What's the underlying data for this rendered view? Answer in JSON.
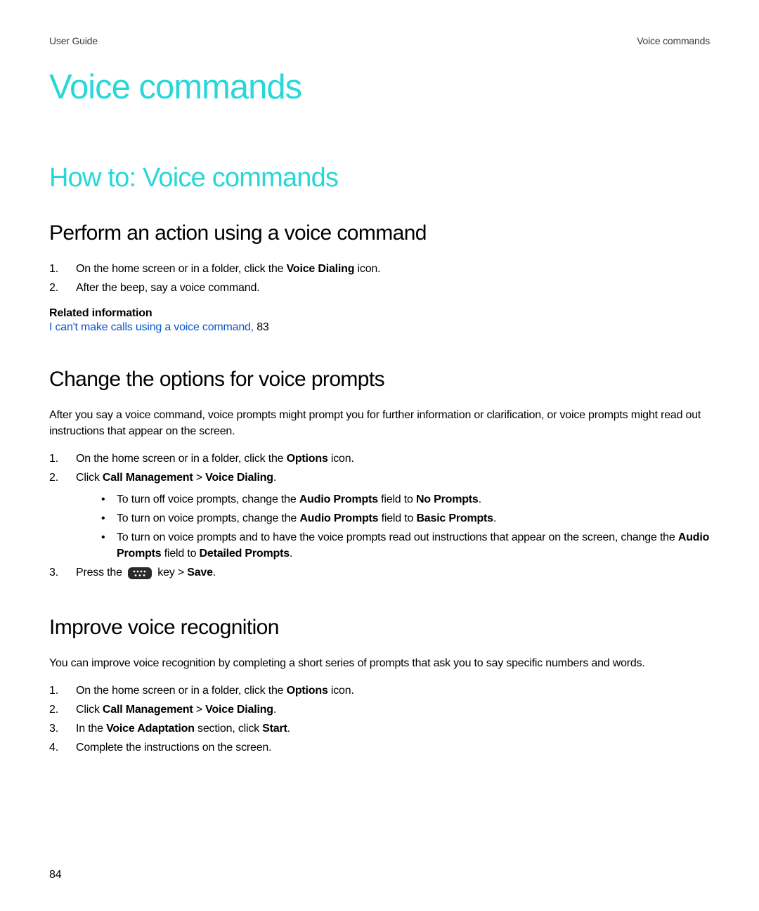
{
  "header": {
    "left": "User Guide",
    "right": "Voice commands"
  },
  "title": "Voice commands",
  "section": "How to: Voice commands",
  "sub1": {
    "title": "Perform an action using a voice command",
    "step1_pre": "On the home screen or in a folder, click the ",
    "step1_bold": "Voice Dialing",
    "step1_post": " icon.",
    "step2": "After the beep, say a voice command.",
    "related_heading": "Related information",
    "related_link": "I can't make calls using a voice command, ",
    "related_page": "83"
  },
  "sub2": {
    "title": "Change the options for voice prompts",
    "intro": "After you say a voice command, voice prompts might prompt you for further information or clarification, or voice prompts might read out instructions that appear on the screen.",
    "step1_pre": "On the home screen or in a folder, click the ",
    "step1_bold": "Options",
    "step1_post": " icon.",
    "step2_pre": "Click ",
    "step2_b1": "Call Management",
    "step2_mid": " > ",
    "step2_b2": "Voice Dialing",
    "step2_post": ".",
    "bullet1_pre": "To turn off voice prompts, change the ",
    "bullet1_b1": "Audio Prompts",
    "bullet1_mid": " field to ",
    "bullet1_b2": "No Prompts",
    "bullet1_post": ".",
    "bullet2_pre": "To turn on voice prompts, change the ",
    "bullet2_b1": "Audio Prompts",
    "bullet2_mid": " field to ",
    "bullet2_b2": "Basic Prompts",
    "bullet2_post": ".",
    "bullet3_pre": "To turn on voice prompts and to have the voice prompts read out instructions that appear on the screen, change the ",
    "bullet3_b1": "Audio Prompts",
    "bullet3_mid": " field to ",
    "bullet3_b2": "Detailed Prompts",
    "bullet3_post": ".",
    "step3_pre": "Press the ",
    "step3_mid": " key > ",
    "step3_bold": "Save",
    "step3_post": "."
  },
  "sub3": {
    "title": "Improve voice recognition",
    "intro": "You can improve voice recognition by completing a short series of prompts that ask you to say specific numbers and words.",
    "step1_pre": "On the home screen or in a folder, click the ",
    "step1_bold": "Options",
    "step1_post": " icon.",
    "step2_pre": "Click ",
    "step2_b1": "Call Management",
    "step2_mid": " > ",
    "step2_b2": "Voice Dialing",
    "step2_post": ".",
    "step3_pre": "In the ",
    "step3_b1": "Voice Adaptation",
    "step3_mid": " section, click ",
    "step3_b2": "Start",
    "step3_post": ".",
    "step4": "Complete the instructions on the screen."
  },
  "page_number": "84",
  "icon_name": "menu-key-icon"
}
